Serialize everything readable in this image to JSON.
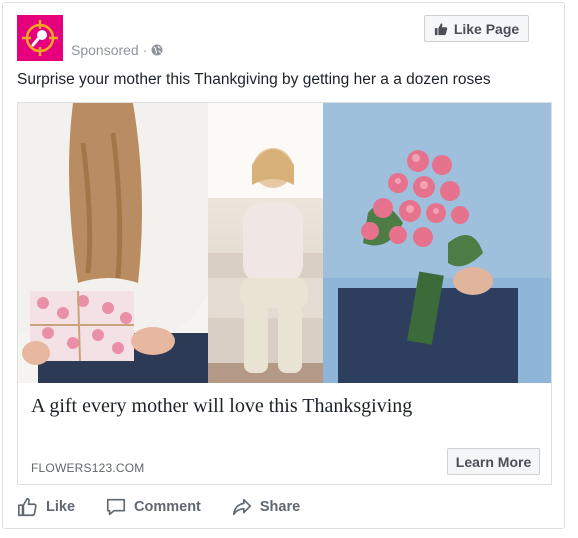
{
  "post": {
    "sponsored_label": "Sponsored",
    "separator": "·",
    "like_page_label": "Like Page",
    "caption": "Surprise your mother this Thankgiving by getting her a a dozen roses"
  },
  "ad": {
    "headline": "A gift every mother will love this Thanksgiving",
    "domain": "FLOWERS123.COM",
    "cta_label": "Learn More"
  },
  "actions": {
    "like": "Like",
    "comment": "Comment",
    "share": "Share"
  },
  "colors": {
    "brand_logo": "#e6007e",
    "logo_accent": "#f5a623",
    "text_primary": "#1d2129",
    "text_secondary": "#606770"
  },
  "icons": [
    "crosshair-logo-icon",
    "globe-icon",
    "thumbs-up-icon",
    "comment-icon",
    "share-icon"
  ]
}
